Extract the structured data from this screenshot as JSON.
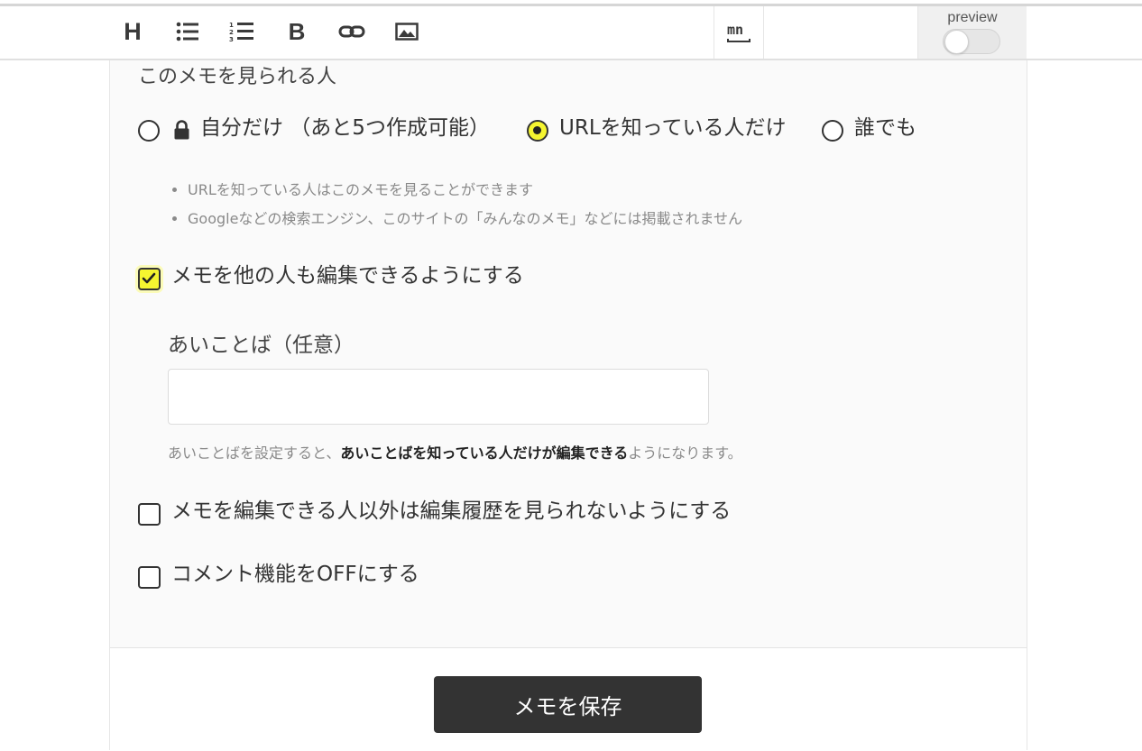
{
  "toolbar": {
    "tools": [
      {
        "icon": "heading-icon",
        "glyph": "H"
      },
      {
        "icon": "bulleted-list-icon"
      },
      {
        "icon": "numbered-list-icon"
      },
      {
        "icon": "bold-icon",
        "glyph": "B"
      },
      {
        "icon": "link-icon"
      },
      {
        "icon": "image-icon"
      }
    ],
    "markdown_icon": "mn",
    "preview_label": "preview",
    "preview_on": false
  },
  "visibility": {
    "title": "このメモを見られる人",
    "options": [
      {
        "label": "自分だけ （あと5つ作成可能）",
        "checked": false,
        "icon": "lock-icon"
      },
      {
        "label": "URLを知っている人だけ",
        "checked": true
      },
      {
        "label": "誰でも",
        "checked": false
      }
    ],
    "notes": [
      "URLを知っている人はこのメモを見ることができます",
      "Googleなどの検索エンジン、このサイトの「みんなのメモ」などには掲載されません"
    ]
  },
  "editable": {
    "label": "メモを他の人も編集できるようにする",
    "checked": true
  },
  "password": {
    "label": "あいことば（任意）",
    "value": "",
    "placeholder": "",
    "hint_before": "あいことばを設定すると、",
    "hint_bold": "あいことばを知っている人だけが編集できる",
    "hint_after": "ようになります。"
  },
  "hide_history": {
    "label": "メモを編集できる人以外は編集履歴を見られないようにする",
    "checked": false
  },
  "comments_off": {
    "label": "コメント機能をOFFにする",
    "checked": false
  },
  "save_button": {
    "label": "メモを保存"
  },
  "colors": {
    "accent": "#f5f530",
    "button": "#333333"
  }
}
